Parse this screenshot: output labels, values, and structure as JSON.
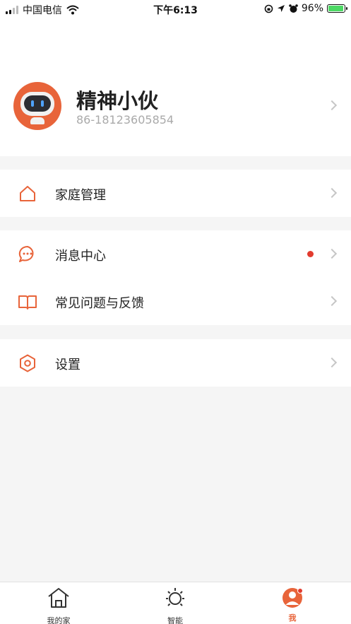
{
  "status_bar": {
    "carrier": "中国电信",
    "time": "下午6:13",
    "battery": "96%",
    "battery_level": 0.96
  },
  "profile": {
    "name": "精神小伙",
    "phone": "86-18123605854",
    "avatar_icon": "robot-avatar-icon"
  },
  "menu": {
    "group1": [
      {
        "label": "家庭管理",
        "icon": "home-icon"
      }
    ],
    "group2": [
      {
        "label": "消息中心",
        "icon": "message-icon",
        "badge": true
      },
      {
        "label": "常见问题与反馈",
        "icon": "book-icon"
      }
    ],
    "group3": [
      {
        "label": "设置",
        "icon": "hexagon-settings-icon"
      }
    ]
  },
  "tabbar": {
    "tabs": [
      {
        "label": "我的家",
        "icon": "house-icon",
        "active": false
      },
      {
        "label": "智能",
        "icon": "sun-icon",
        "active": false
      },
      {
        "label": "我",
        "icon": "user-icon",
        "active": true,
        "badge": true
      }
    ]
  },
  "colors": {
    "accent": "#e8643a",
    "badge": "#e23b2e",
    "background": "#f5f5f5"
  }
}
